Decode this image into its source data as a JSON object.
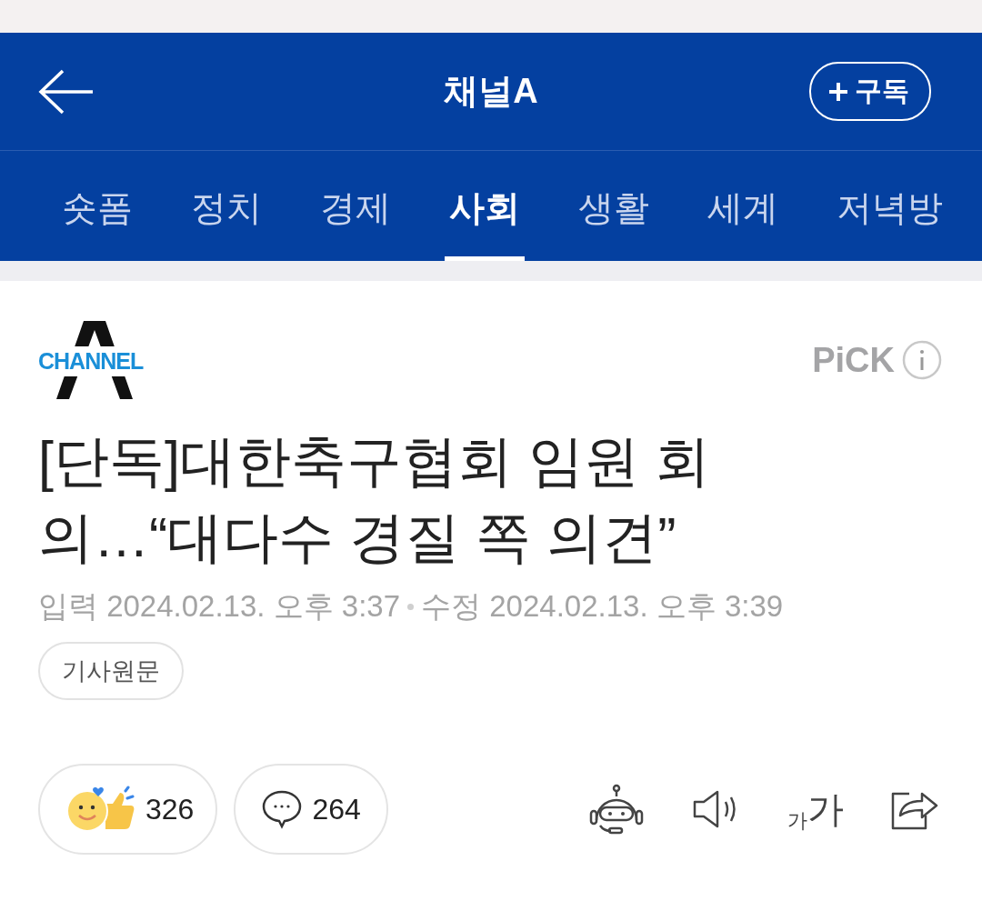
{
  "header": {
    "title": "채널A",
    "subscribe": "구독"
  },
  "tabs": [
    {
      "label": "숏폼",
      "selected": false
    },
    {
      "label": "정치",
      "selected": false
    },
    {
      "label": "경제",
      "selected": false
    },
    {
      "label": "사회",
      "selected": true
    },
    {
      "label": "생활",
      "selected": false
    },
    {
      "label": "세계",
      "selected": false
    },
    {
      "label": "저녁방",
      "selected": false
    }
  ],
  "article": {
    "logo_text": "CHANNEL",
    "pick": "PiCK",
    "headline": "[단독]대한축구협회 임원 회의…“대다수 경질 쪽 의견”",
    "dates": [
      {
        "label": "입력",
        "value": "2024.02.13. 오후 3:37"
      },
      {
        "label": "수정",
        "value": "2024.02.13. 오후 3:39"
      }
    ],
    "original_link": "기사원문"
  },
  "actions": {
    "reactions": "326",
    "comments": "264",
    "font_small": "가",
    "font_large": "가"
  }
}
